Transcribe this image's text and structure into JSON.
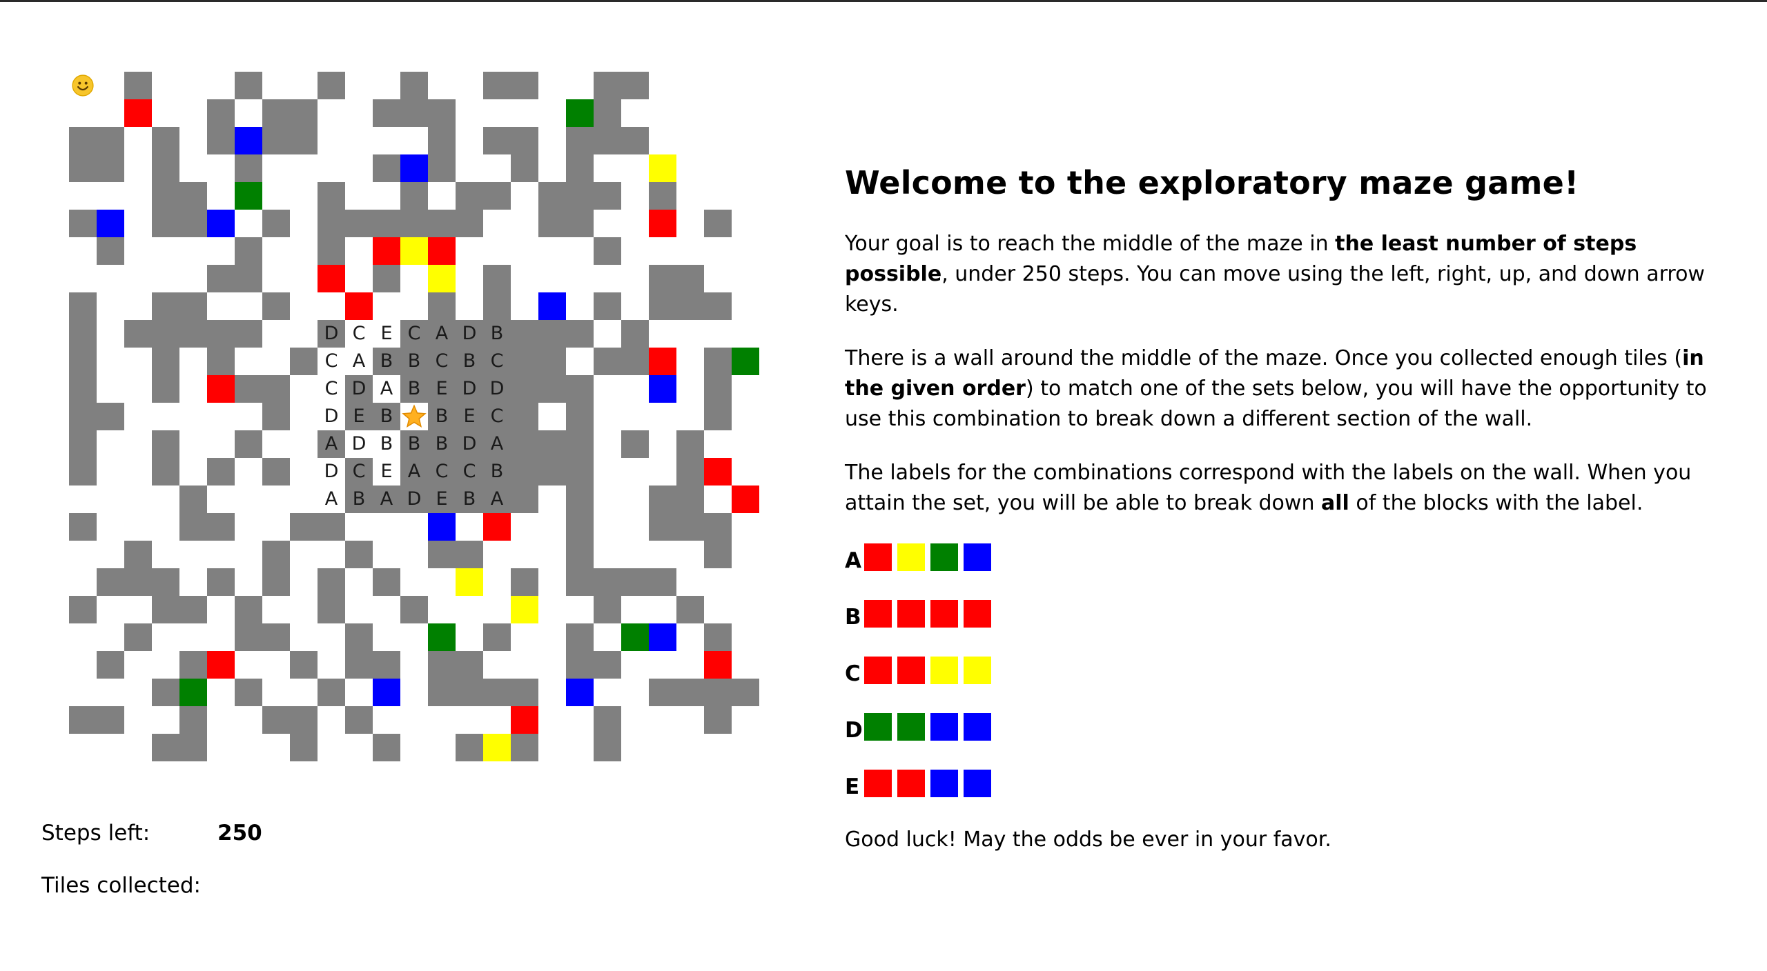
{
  "maze": {
    "rows": [
      "  W   W  W  W  WW  WW",
      "  R  W WW  WWW    GW",
      "WW W WBWW    W WW WWW",
      "WW W  W    WBW  W W  Y",
      "   WW G  W  W WW WWW W",
      "WB WWB W WWWWWW  WW  R W",
      " W    W  W RYR     W",
      "     WW  R W Y W     WW  W W",
      "W  WW  W  R  W W B W WWW  W W",
      "W WWWWW  W  LLLLLLL W     WW",
      "W  W W  W  LLLLLLL WWR WGW",
      "W  W RWW  W LLLLLLL  B W",
      "WW     W  LLLLLLL W    W W",
      "W  W  W  W  LLLLLLL W W   WW",
      "W  W W W  W LLLLLLL   WR    W",
      "    W     LLLLLLL W  WW R",
      "W   WW  WW   B R  W  WWW  W",
      "  W    W  W  WW   W    W",
      " WWW W W W W  Y W WWWW",
      "W  WW W  W  W   Y  W  W",
      "  W   WW  W  G W  W GB W",
      " W  WR  W WW WW   WW   R",
      "   WG W  W B WWWW B  WWWW",
      "WW  W  WW W     R  W   W",
      "   WW   W  W  WYW  W"
    ],
    "wall_labels": [
      [
        "D",
        "C",
        "E",
        "C",
        "A",
        "D",
        "B"
      ],
      [
        "C",
        "A",
        "B",
        "B",
        "C",
        "B",
        "C"
      ],
      [
        "C",
        "D",
        "A",
        "B",
        "E",
        "D",
        "D"
      ],
      [
        "D",
        "E",
        "B",
        "",
        "B",
        "E",
        "C"
      ],
      [
        "A",
        "D",
        "B",
        "B",
        "B",
        "D",
        "A"
      ],
      [
        "D",
        "C",
        "E",
        "A",
        "C",
        "C",
        "B"
      ],
      [
        "A",
        "B",
        "A",
        "D",
        "E",
        "B",
        "A"
      ]
    ],
    "player_icon": "smiley-icon",
    "goal_icon": "star-icon"
  },
  "status": {
    "steps_label": "Steps left:",
    "steps_value": "250",
    "tiles_label": "Tiles collected:"
  },
  "info": {
    "title": "Welcome to the exploratory maze game!",
    "p1_a": "Your goal is to reach the middle of the maze in ",
    "p1_b": "the least number of steps possible",
    "p1_c": ", under 250 steps. You can move using the left, right, up, and down arrow keys.",
    "p2_a": "There is a wall around the middle of the maze. Once you collected enough tiles (",
    "p2_b": "in the given order",
    "p2_c": ") to match one of the sets below, you will have the opportunity to use this combination to break down a different section of the wall.",
    "p3_a": "The labels for the combinations correspond with the labels on the wall. When you attain the set, you will be able to break down ",
    "p3_b": "all",
    "p3_c": " of the blocks with the label.",
    "combinations": [
      {
        "label": "A",
        "colors": [
          "red",
          "yellow",
          "green",
          "blue"
        ]
      },
      {
        "label": "B",
        "colors": [
          "red",
          "red",
          "red",
          "red"
        ]
      },
      {
        "label": "C",
        "colors": [
          "red",
          "red",
          "yellow",
          "yellow"
        ]
      },
      {
        "label": "D",
        "colors": [
          "green",
          "green",
          "blue",
          "blue"
        ]
      },
      {
        "label": "E",
        "colors": [
          "red",
          "red",
          "blue",
          "blue"
        ]
      }
    ],
    "good_luck": "Good luck! May the odds be ever in your favor."
  },
  "colors": {
    "wall": "#808080",
    "red": "#ff0000",
    "yellow": "#ffff00",
    "green": "#008000",
    "blue": "#0000ff"
  }
}
